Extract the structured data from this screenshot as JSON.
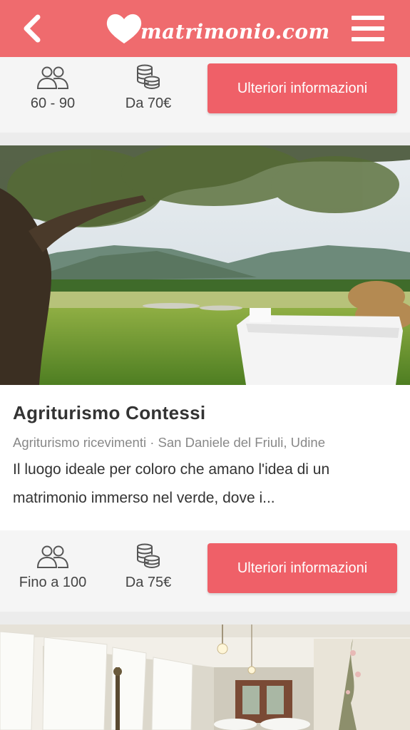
{
  "header": {
    "brand": "matrimonio.com",
    "back_icon": "chevron-left-icon",
    "menu_icon": "hamburger-menu-icon",
    "color": "#ef6b6e"
  },
  "listings": [
    {
      "guests": "60 - 90",
      "price": "Da 70€",
      "cta": "Ulteriori informazioni"
    },
    {
      "name": "Agriturismo Contessi",
      "category": "Agriturismo ricevimenti",
      "location": "San Daniele del Friuli, Udine",
      "subtitle": "Agriturismo ricevimenti · San Daniele del Friuli, Udine",
      "description": "Il luogo ideale per coloro che amano l'idea di un matrimonio immerso nel verde, dove i...",
      "guests": "Fino a 100",
      "price": "Da 75€",
      "cta": "Ulteriori informazioni"
    }
  ],
  "icons": {
    "guests": "people-icon",
    "price": "coins-icon"
  },
  "accent_color": "#ef6068"
}
